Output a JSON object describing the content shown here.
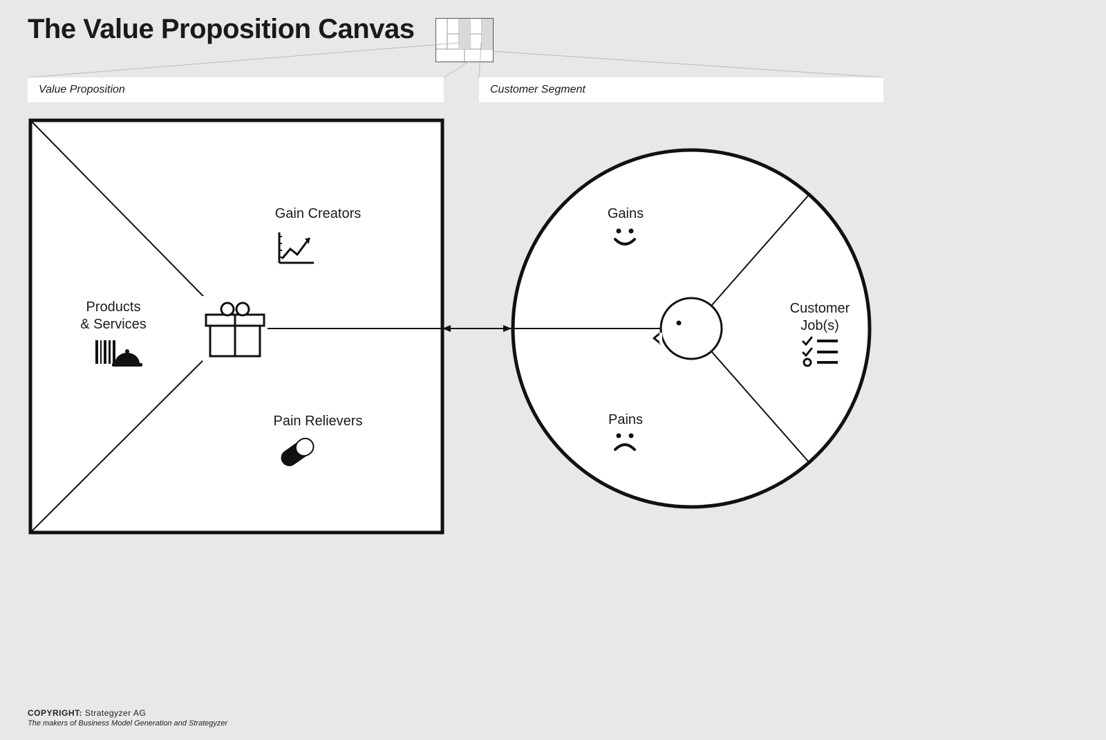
{
  "title": "The Value Proposition Canvas",
  "sections": {
    "value_proposition_label": "Value Proposition",
    "customer_segment_label": "Customer Segment"
  },
  "square": {
    "gain_creators": "Gain Creators",
    "pain_relievers": "Pain Relievers",
    "products_services_line1": "Products",
    "products_services_line2": "& Services"
  },
  "circle": {
    "gains": "Gains",
    "pains": "Pains",
    "customer_jobs_line1": "Customer",
    "customer_jobs_line2": "Job(s)"
  },
  "icons": {
    "gift": "gift-icon",
    "chart_up": "chart-up-icon",
    "pill": "pill-icon",
    "barcode_cloche": "barcode-cloche-icon",
    "smile": "smile-icon",
    "frown": "frown-icon",
    "face_profile": "face-profile-icon",
    "checklist": "checklist-icon"
  },
  "footer": {
    "copyright_label": "COPYRIGHT:",
    "owner": "Strategyzer AG",
    "tagline": "The makers of Business Model Generation and Strategyzer"
  }
}
